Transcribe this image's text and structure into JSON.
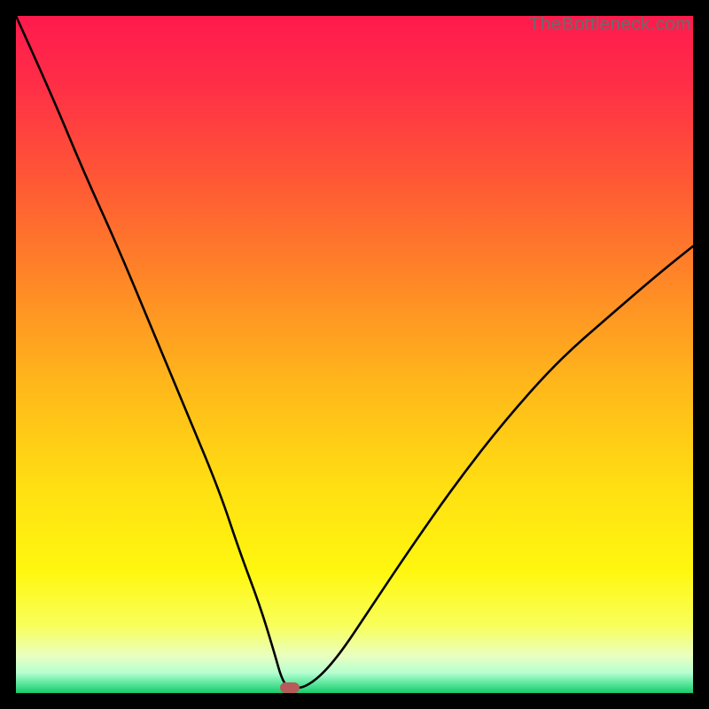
{
  "watermark": "TheBottleneck.com",
  "marker": {
    "x_pct": 40.5,
    "y_pct": 99.2
  },
  "gradient": {
    "stops": [
      {
        "offset": 0.0,
        "color": "#ff1a4d"
      },
      {
        "offset": 0.1,
        "color": "#ff2e47"
      },
      {
        "offset": 0.25,
        "color": "#ff5a34"
      },
      {
        "offset": 0.4,
        "color": "#ff8a26"
      },
      {
        "offset": 0.55,
        "color": "#ffb91a"
      },
      {
        "offset": 0.7,
        "color": "#ffe012"
      },
      {
        "offset": 0.82,
        "color": "#fff70f"
      },
      {
        "offset": 0.9,
        "color": "#f8ff5a"
      },
      {
        "offset": 0.945,
        "color": "#eaffc0"
      },
      {
        "offset": 0.97,
        "color": "#b6ffd0"
      },
      {
        "offset": 0.985,
        "color": "#60e8a0"
      },
      {
        "offset": 1.0,
        "color": "#18c96b"
      }
    ]
  },
  "chart_data": {
    "type": "line",
    "title": "",
    "xlabel": "",
    "ylabel": "",
    "xlim": [
      0,
      100
    ],
    "ylim": [
      0,
      100
    ],
    "series": [
      {
        "name": "bottleneck-curve",
        "x": [
          0,
          5,
          10,
          15,
          20,
          25,
          30,
          33,
          36,
          38,
          39.5,
          41,
          42.5,
          45,
          48,
          52,
          58,
          65,
          72,
          80,
          88,
          95,
          100
        ],
        "y": [
          100,
          89,
          77,
          66,
          54,
          42,
          30,
          21,
          13,
          6.5,
          1.2,
          0.8,
          0.8,
          2.5,
          6,
          12,
          21,
          31,
          40,
          49,
          56,
          62,
          66
        ]
      }
    ],
    "marker_point": {
      "x": 41,
      "y": 0.8
    }
  }
}
